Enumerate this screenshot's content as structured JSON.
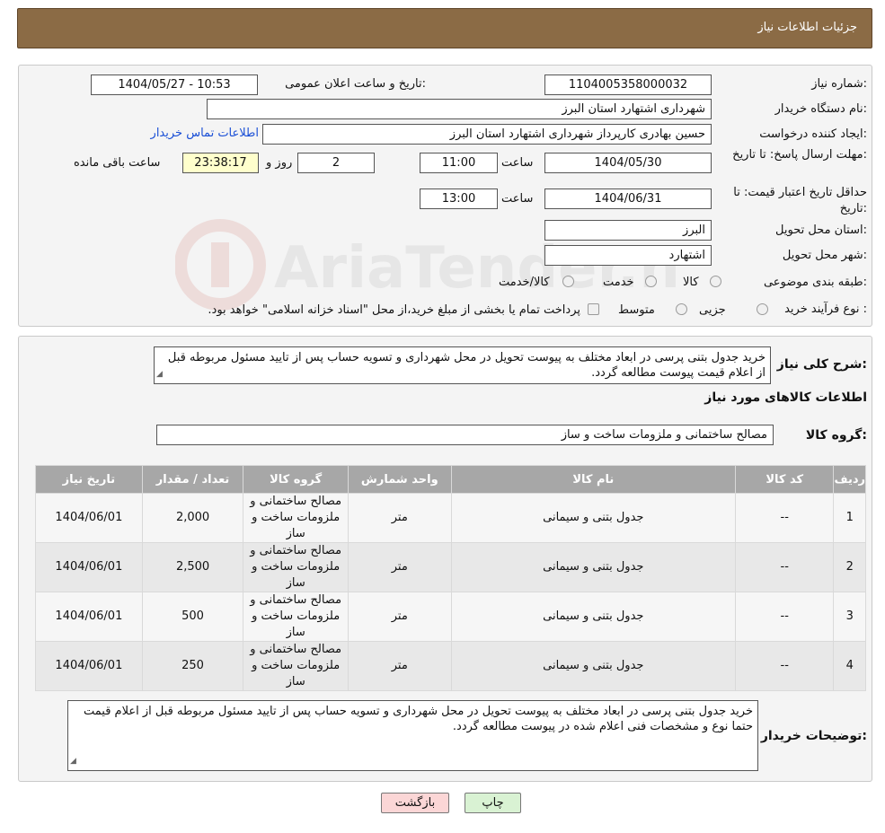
{
  "header": {
    "title": "جزئیات اطلاعات نیاز"
  },
  "details": {
    "need_number_label": "شماره نیاز:",
    "need_number": "1104005358000032",
    "announce_label": "تاریخ و ساعت اعلان عمومی:",
    "announce_value": "1404/05/27 - 10:53",
    "buyer_org_label": "نام دستگاه خریدار:",
    "buyer_org": "شهرداری اشتهارد استان البرز",
    "requester_label": "ایجاد کننده درخواست:",
    "requester": "حسین بهادری کارپرداز شهرداری اشتهارد استان البرز",
    "contact_link": "اطلاعات تماس خریدار",
    "deadline_label": "مهلت ارسال پاسخ: تا تاریخ:",
    "deadline_date": "1404/05/30",
    "time_label": "ساعت",
    "deadline_time": "11:00",
    "days_value": "2",
    "days_label": "روز و",
    "remaining_time": "23:38:17",
    "remaining_label": "ساعت باقی مانده",
    "min_validity_label": "حداقل تاریخ اعتبار قیمت: تا تاریخ:",
    "min_validity_date": "1404/06/31",
    "min_validity_time": "13:00",
    "province_label": "استان محل تحویل:",
    "province": "البرز",
    "city_label": "شهر محل تحویل:",
    "city": "اشتهارد",
    "category_label": "طبقه بندی موضوعی:",
    "category_options": [
      "کالا",
      "خدمت",
      "کالا/خدمت"
    ],
    "purchase_type_label": "نوع فرآیند خرید :",
    "purchase_options": [
      "جزیی",
      "متوسط"
    ],
    "purchase_note": "پرداخت تمام یا بخشی از مبلغ خرید،از محل \"اسناد خزانه اسلامی\" خواهد بود."
  },
  "summary": {
    "label": "شرح کلی نیاز:",
    "text": "خرید جدول بتنی پرسی در ابعاد مختلف به پیوست تحویل در محل شهرداری و تسویه حساب پس از تایید مسئول مربوطه قبل از اعلام قیمت پیوست مطالعه گردد.",
    "items_heading": "اطلاعات کالاهای مورد نیاز",
    "group_label": "گروه کالا:",
    "group_value": "مصالح ساختمانی و ملزومات ساخت و ساز"
  },
  "table": {
    "headers": [
      "ردیف",
      "کد کالا",
      "نام کالا",
      "واحد شمارش",
      "گروه کالا",
      "تعداد / مقدار",
      "تاریخ نیاز"
    ],
    "rows": [
      [
        "1",
        "--",
        "جدول بتنی و سیمانی",
        "متر",
        "مصالح ساختمانی و ملزومات ساخت و ساز",
        "2,000",
        "1404/06/01"
      ],
      [
        "2",
        "--",
        "جدول بتنی و سیمانی",
        "متر",
        "مصالح ساختمانی و ملزومات ساخت و ساز",
        "2,500",
        "1404/06/01"
      ],
      [
        "3",
        "--",
        "جدول بتنی و سیمانی",
        "متر",
        "مصالح ساختمانی و ملزومات ساخت و ساز",
        "500",
        "1404/06/01"
      ],
      [
        "4",
        "--",
        "جدول بتنی و سیمانی",
        "متر",
        "مصالح ساختمانی و ملزومات ساخت و ساز",
        "250",
        "1404/06/01"
      ]
    ]
  },
  "buyer_notes": {
    "label": "توضیحات خریدار:",
    "text": "خرید جدول بتنی پرسی در ابعاد مختلف به پیوست تحویل در محل شهرداری و تسویه حساب پس از تایید مسئول مربوطه قبل از اعلام قیمت حتما نوع و مشخصات فنی  اعلام شده در پیوست مطالعه گردد."
  },
  "buttons": {
    "back": "بازگشت",
    "print": "چاپ"
  },
  "watermark": {
    "text": "AriaTender.neT"
  },
  "colors": {
    "header_bg": "#8b6b45",
    "link": "#1a4fd6",
    "table_header": "#a7a7a7"
  }
}
